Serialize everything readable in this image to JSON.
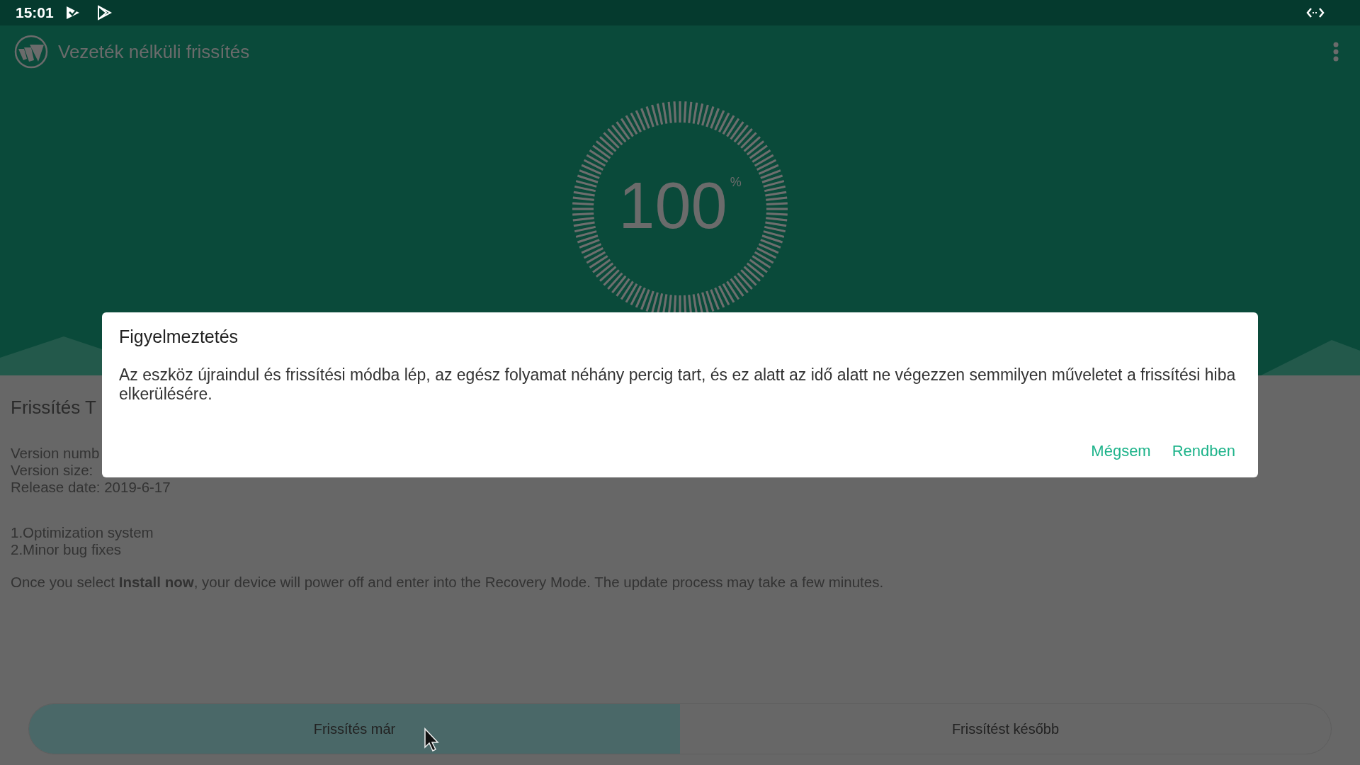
{
  "status_bar": {
    "time": "15:01"
  },
  "app_bar": {
    "title": "Vezeték nélküli frissítés"
  },
  "progress": {
    "value": "100",
    "unit": "%",
    "level": 1
  },
  "details": {
    "heading": "Frissítés T",
    "info_lines": [
      "Version numb",
      "Version size:",
      "Release date: 2019-6-17"
    ],
    "changes": [
      "1.Optimization system",
      "2.Minor bug fixes"
    ],
    "note": "Once you select **Install now**, your device will power off and enter into the Recovery Mode. The update process may take a few minutes."
  },
  "actions": [
    {
      "label": "Frissítés már",
      "selected": true
    },
    {
      "label": "Frissítést később",
      "selected": false
    }
  ],
  "dialog": {
    "title": "Figyelmeztetés",
    "message": "Az eszköz újraindul és frissítési módba lép, az egész folyamat néhány percig tart, és ez alatt az idő alatt ne végezzen semmilyen műveletet a frissítési hiba elkerülésére.",
    "buttons": [
      "Mégsem",
      "Rendben"
    ]
  }
}
